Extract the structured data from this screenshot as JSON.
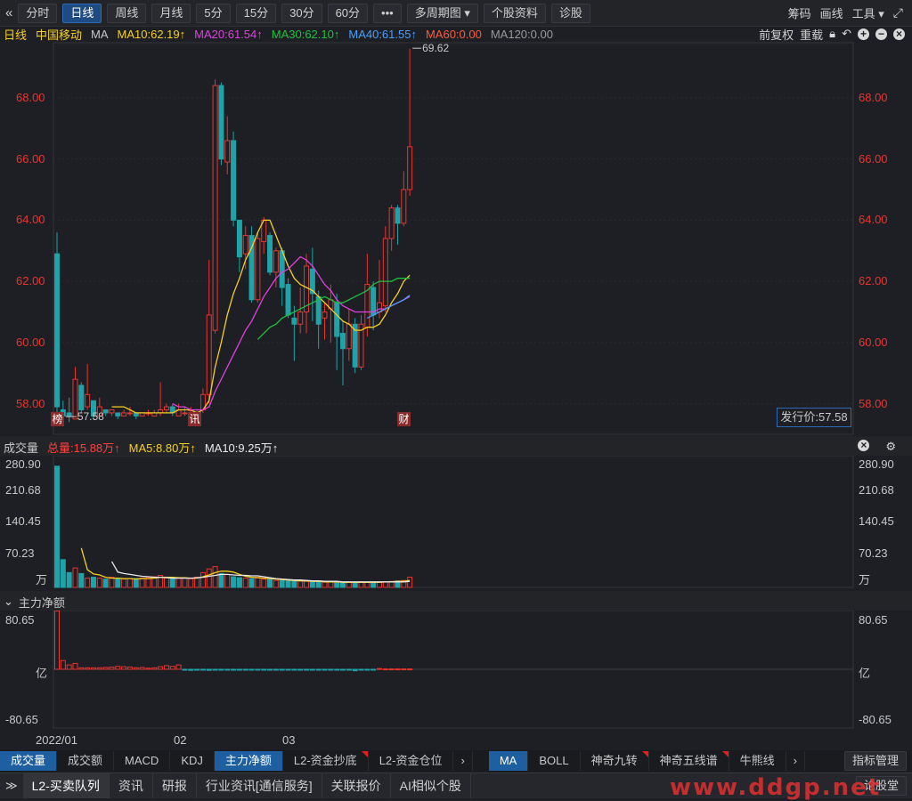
{
  "toolbar": {
    "back_icon": "chevron-double-left",
    "buttons": [
      "分时",
      "日线",
      "周线",
      "月线",
      "5分",
      "15分",
      "30分",
      "60分",
      "•••",
      "多周期图 ▾",
      "个股资料",
      "诊股"
    ],
    "active": "日线",
    "right": [
      "筹码",
      "画线",
      "工具 ▾"
    ],
    "fullscreen_icon": "expand-arrows"
  },
  "ma_line": {
    "period": "日线",
    "stock": "中国移动",
    "label": "MA",
    "items": [
      {
        "text": "MA10:62.19↑",
        "color": "#f5d020"
      },
      {
        "text": "MA20:61.54↑",
        "color": "#e040e0"
      },
      {
        "text": "MA30:62.10↑",
        "color": "#20c040"
      },
      {
        "text": "MA40:61.55↑",
        "color": "#4aa0ff"
      },
      {
        "text": "MA60:0.00",
        "color": "#ff5a3c"
      },
      {
        "text": "MA120:0.00",
        "color": "#9a9a9a"
      }
    ],
    "right_links": [
      "前复权",
      "重载"
    ],
    "right_icons": [
      "lock-icon",
      "undo-icon",
      "plus-circle-icon",
      "minus-circle-icon",
      "close-circle-icon"
    ]
  },
  "price_axis": [
    "68.00",
    "66.00",
    "64.00",
    "62.00",
    "60.00",
    "58.00"
  ],
  "annotations": {
    "high": "69.62",
    "low": "57.58",
    "issue_price": "发行价:57.58"
  },
  "markers": [
    "榜",
    "讯",
    "财"
  ],
  "volume_panel": {
    "title": "成交量",
    "items": [
      {
        "text": "总量:15.88万↑",
        "color": "#ff4040"
      },
      {
        "text": "MA5:8.80万↑",
        "color": "#f5d020"
      },
      {
        "text": "MA10:9.25万↑",
        "color": "#e8e8e8"
      }
    ],
    "axis": [
      "280.90",
      "210.68",
      "140.45",
      "70.23",
      "万"
    ]
  },
  "flow_panel": {
    "title": "主力净额",
    "axis": [
      "80.65",
      "亿",
      "-80.65"
    ]
  },
  "x_axis": [
    "2022/01",
    "02",
    "03"
  ],
  "tabs_left": [
    {
      "label": "成交量",
      "active": true,
      "flag": false
    },
    {
      "label": "成交额",
      "active": false,
      "flag": false
    },
    {
      "label": "MACD",
      "active": false,
      "flag": false
    },
    {
      "label": "KDJ",
      "active": false,
      "flag": false
    },
    {
      "label": "主力净额",
      "active": true,
      "flag": false
    },
    {
      "label": "L2-资金抄底",
      "active": false,
      "flag": true
    },
    {
      "label": "L2-资金仓位",
      "active": false,
      "flag": false
    }
  ],
  "tabs_right": [
    {
      "label": "MA",
      "active": true,
      "flag": false
    },
    {
      "label": "BOLL",
      "active": false,
      "flag": false
    },
    {
      "label": "神奇九转",
      "active": false,
      "flag": true
    },
    {
      "label": "神奇五线谱",
      "active": false,
      "flag": true
    },
    {
      "label": "牛熊线",
      "active": false,
      "flag": false
    }
  ],
  "tab_more": "›",
  "manage_btn": "指标管理",
  "bottom_tabs": [
    "L2-买卖队列",
    "资讯",
    "研报",
    "行业资讯[通信服务]",
    "关联报价",
    "AI相似个股"
  ],
  "bottom_active": "L2-买卖队列",
  "bottom_right": "论股堂",
  "watermark": "www.ddgp.net",
  "colors": {
    "up": "#e8352e",
    "down": "#1fa3a8",
    "ma10": "#f5d020",
    "ma20": "#e040e0",
    "ma30": "#20c040",
    "ma40": "#4aa0ff"
  },
  "chart_data": {
    "type": "candlestick",
    "ylim": [
      57.0,
      69.8
    ],
    "candles": [
      [
        62.9,
        57.9,
        63.6,
        57.7
      ],
      [
        57.8,
        57.6,
        58.1,
        57.4
      ],
      [
        57.7,
        57.6,
        58.2,
        57.4
      ],
      [
        57.5,
        58.8,
        59.2,
        57.5
      ],
      [
        58.6,
        57.8,
        58.7,
        57.7
      ],
      [
        57.9,
        58.3,
        59.3,
        57.8
      ],
      [
        58.1,
        57.6,
        58.1,
        57.5
      ],
      [
        57.6,
        57.9,
        58.2,
        57.6
      ],
      [
        57.8,
        57.7,
        57.8,
        57.6
      ],
      [
        57.7,
        57.8,
        57.8,
        57.6
      ],
      [
        57.7,
        57.6,
        57.7,
        57.5
      ],
      [
        57.6,
        57.7,
        57.8,
        57.6
      ],
      [
        57.7,
        57.7,
        57.9,
        57.6
      ],
      [
        57.7,
        57.6,
        57.7,
        57.5
      ],
      [
        57.6,
        57.7,
        57.7,
        57.6
      ],
      [
        57.7,
        57.7,
        57.8,
        57.6
      ],
      [
        57.6,
        57.7,
        57.8,
        57.6
      ],
      [
        57.7,
        57.8,
        58.7,
        57.6
      ],
      [
        57.8,
        57.9,
        58.0,
        57.7
      ],
      [
        57.9,
        57.7,
        58.0,
        57.6
      ],
      [
        57.6,
        57.8,
        58.0,
        57.6
      ],
      [
        57.7,
        57.7,
        57.9,
        57.6
      ],
      [
        57.8,
        57.8,
        57.9,
        57.7
      ],
      [
        57.7,
        57.7,
        57.8,
        57.6
      ],
      [
        57.8,
        58.3,
        58.5,
        57.7
      ],
      [
        58.3,
        60.9,
        62.7,
        58.0
      ],
      [
        60.4,
        68.4,
        68.6,
        60.3
      ],
      [
        68.4,
        66.0,
        68.5,
        65.8
      ],
      [
        65.9,
        66.6,
        67.4,
        65.5
      ],
      [
        66.6,
        64.0,
        66.9,
        63.8
      ],
      [
        64.0,
        62.8,
        64.0,
        62.3
      ],
      [
        62.9,
        63.5,
        63.8,
        62.4
      ],
      [
        63.5,
        61.4,
        63.8,
        61.3
      ],
      [
        61.4,
        63.4,
        63.6,
        61.3
      ],
      [
        63.3,
        64.0,
        64.1,
        62.9
      ],
      [
        63.5,
        62.3,
        63.6,
        62.2
      ],
      [
        62.3,
        63.0,
        63.1,
        61.8
      ],
      [
        63.0,
        61.8,
        63.1,
        61.2
      ],
      [
        61.9,
        60.9,
        62.1,
        60.8
      ],
      [
        60.8,
        60.6,
        61.2,
        59.4
      ],
      [
        60.6,
        61.0,
        61.8,
        60.3
      ],
      [
        61.0,
        62.5,
        62.9,
        60.3
      ],
      [
        62.4,
        61.6,
        63.1,
        60.7
      ],
      [
        61.5,
        60.6,
        61.7,
        59.8
      ],
      [
        60.8,
        61.0,
        61.3,
        60.1
      ],
      [
        61.1,
        61.4,
        61.9,
        60.0
      ],
      [
        61.3,
        60.2,
        61.6,
        59.1
      ],
      [
        60.3,
        59.8,
        60.7,
        58.6
      ],
      [
        59.8,
        60.6,
        61.1,
        59.4
      ],
      [
        60.6,
        59.2,
        60.8,
        59.0
      ],
      [
        59.2,
        60.6,
        60.9,
        59.1
      ],
      [
        60.5,
        61.9,
        62.9,
        60.2
      ],
      [
        61.8,
        60.9,
        62.0,
        60.4
      ],
      [
        61.0,
        61.3,
        62.7,
        60.8
      ],
      [
        61.2,
        63.4,
        63.8,
        61.0
      ],
      [
        63.4,
        64.4,
        64.5,
        63.0
      ],
      [
        64.4,
        63.9,
        64.5,
        63.2
      ],
      [
        63.9,
        65.0,
        65.6,
        63.8
      ],
      [
        65.0,
        66.4,
        69.6,
        64.8
      ]
    ],
    "ma10": [
      null,
      null,
      null,
      null,
      null,
      null,
      null,
      null,
      null,
      57.9,
      57.9,
      57.9,
      57.8,
      57.7,
      57.7,
      57.7,
      57.7,
      57.7,
      57.7,
      57.7,
      57.8,
      57.8,
      57.8,
      57.7,
      57.8,
      58.1,
      59.2,
      60.0,
      60.9,
      61.6,
      62.1,
      62.7,
      63.1,
      63.6,
      64.0,
      64.0,
      63.5,
      63.0,
      62.5,
      62.1,
      61.9,
      61.8,
      61.7,
      61.5,
      61.3,
      61.1,
      60.9,
      60.7,
      60.6,
      60.4,
      60.4,
      60.5,
      60.5,
      60.6,
      60.9,
      61.3,
      61.6,
      62.0,
      62.2
    ],
    "ma20": [
      null,
      null,
      null,
      null,
      null,
      null,
      null,
      null,
      null,
      null,
      null,
      null,
      null,
      null,
      null,
      null,
      null,
      null,
      null,
      58.0,
      57.9,
      57.9,
      57.8,
      57.8,
      57.8,
      57.9,
      58.4,
      58.8,
      59.2,
      59.6,
      60.0,
      60.4,
      60.7,
      61.1,
      61.5,
      61.8,
      62.1,
      62.3,
      62.4,
      62.6,
      62.8,
      62.7,
      62.5,
      62.2,
      61.9,
      61.7,
      61.4,
      61.2,
      61.1,
      61.0,
      61.0,
      61.0,
      61.0,
      61.1,
      61.1,
      61.2,
      61.3,
      61.4,
      61.5
    ],
    "ma30": [
      null,
      null,
      null,
      null,
      null,
      null,
      null,
      null,
      null,
      null,
      null,
      null,
      null,
      null,
      null,
      null,
      null,
      null,
      null,
      null,
      null,
      null,
      null,
      null,
      null,
      null,
      null,
      null,
      null,
      null,
      null,
      null,
      null,
      60.1,
      60.3,
      60.5,
      60.6,
      60.8,
      60.9,
      61.0,
      61.1,
      61.2,
      61.3,
      61.4,
      61.5,
      61.4,
      61.3,
      61.3,
      61.4,
      61.5,
      61.6,
      61.7,
      61.9,
      62.0,
      62.0,
      62.0,
      62.1,
      62.1,
      62.1
    ],
    "ma40": [
      null,
      null,
      null,
      null,
      null,
      null,
      null,
      null,
      null,
      null,
      null,
      null,
      null,
      null,
      null,
      null,
      null,
      null,
      null,
      null,
      null,
      null,
      null,
      null,
      null,
      null,
      null,
      null,
      null,
      null,
      null,
      null,
      null,
      null,
      null,
      null,
      null,
      null,
      null,
      null,
      null,
      null,
      null,
      null,
      null,
      null,
      null,
      null,
      null,
      null,
      null,
      60.8,
      60.9,
      61.0,
      61.1,
      61.2,
      61.3,
      61.4,
      61.55
    ],
    "volume_ylim": [
      0,
      280.9
    ],
    "volume": [
      262,
      60,
      32,
      42,
      30,
      20,
      22,
      20,
      18,
      22,
      20,
      18,
      19,
      19,
      20,
      22,
      23,
      26,
      21,
      20,
      20,
      20,
      19,
      22,
      32,
      40,
      45,
      30,
      28,
      23,
      21,
      20,
      19,
      22,
      18,
      17,
      15,
      15,
      14,
      14,
      14,
      13,
      13,
      12,
      12,
      12,
      11,
      11,
      11,
      10,
      12,
      11,
      12,
      11,
      12,
      13,
      14,
      15,
      22
    ],
    "vol_ma5": [
      null,
      null,
      null,
      null,
      85,
      38,
      29,
      27,
      22,
      20,
      20,
      19,
      19,
      18,
      19,
      19,
      20,
      22,
      22,
      22,
      21,
      21,
      20,
      20,
      23,
      27,
      32,
      35,
      35,
      33,
      28,
      24,
      22,
      21,
      20,
      19,
      18,
      17,
      16,
      15,
      14,
      14,
      13,
      13,
      12,
      12,
      12,
      11,
      11,
      11,
      11,
      11,
      11,
      11,
      12,
      12,
      13,
      13,
      15
    ],
    "vol_ma10": [
      null,
      null,
      null,
      null,
      null,
      null,
      null,
      null,
      null,
      56,
      33,
      30,
      28,
      26,
      24,
      23,
      22,
      22,
      21,
      20,
      20,
      20,
      20,
      21,
      22,
      24,
      26,
      28,
      28,
      27,
      26,
      26,
      25,
      25,
      23,
      21,
      19,
      18,
      17,
      16,
      16,
      15,
      14,
      14,
      13,
      13,
      13,
      12,
      12,
      12,
      12,
      12,
      12,
      12,
      12,
      12,
      12,
      12,
      13
    ],
    "flow_ylim": [
      -80.65,
      80.65
    ],
    "flow": [
      80.0,
      12.0,
      6.0,
      8.0,
      2.0,
      2.0,
      2.0,
      2.0,
      2.5,
      3.0,
      4.0,
      3.5,
      3.0,
      2.0,
      2.5,
      1.5,
      2.0,
      3.5,
      5.0,
      4.0,
      6.0,
      -1.0,
      -1.5,
      -1.0,
      -1.0,
      -1.5,
      -1.0,
      -1.2,
      -0.5,
      -0.5,
      -0.5,
      -0.4,
      -0.5,
      -0.5,
      -0.5,
      -0.5,
      -0.5,
      -0.5,
      -0.5,
      -0.5,
      -0.5,
      -0.5,
      -0.5,
      -0.5,
      -0.5,
      -0.5,
      -0.5,
      -0.5,
      -0.5,
      -2.0,
      -0.5,
      -0.5,
      -0.5,
      1.0,
      0.5,
      0.5,
      0.5,
      0.5,
      0.5
    ]
  }
}
